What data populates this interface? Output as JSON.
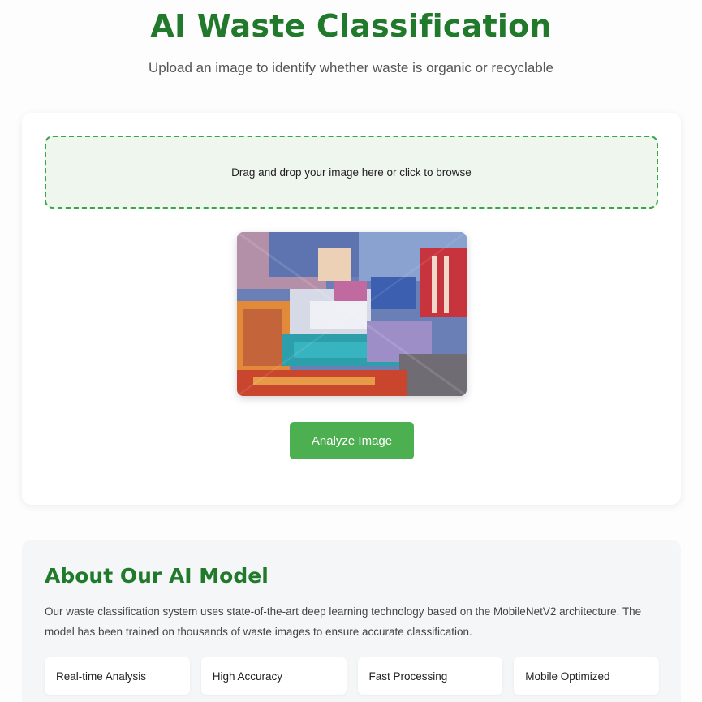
{
  "header": {
    "title": "AI Waste Classification",
    "subtitle": "Upload an image to identify whether waste is organic or recyclable"
  },
  "upload": {
    "dropzone_text": "Drag and drop your image here or click to browse",
    "analyze_label": "Analyze Image",
    "preview_alt": "colorful textile scraps"
  },
  "about": {
    "title": "About Our AI Model",
    "description": "Our waste classification system uses state-of-the-art deep learning technology based on the MobileNetV2 architecture. The model has been trained on thousands of waste images to ensure accurate classification.",
    "features": [
      "Real-time Analysis",
      "High Accuracy",
      "Fast Processing",
      "Mobile Optimized"
    ]
  },
  "colors": {
    "brand_green": "#217a2c",
    "button_green": "#4caf50",
    "dropzone_border": "#3aa64a",
    "dropzone_bg": "#eef6ee"
  }
}
